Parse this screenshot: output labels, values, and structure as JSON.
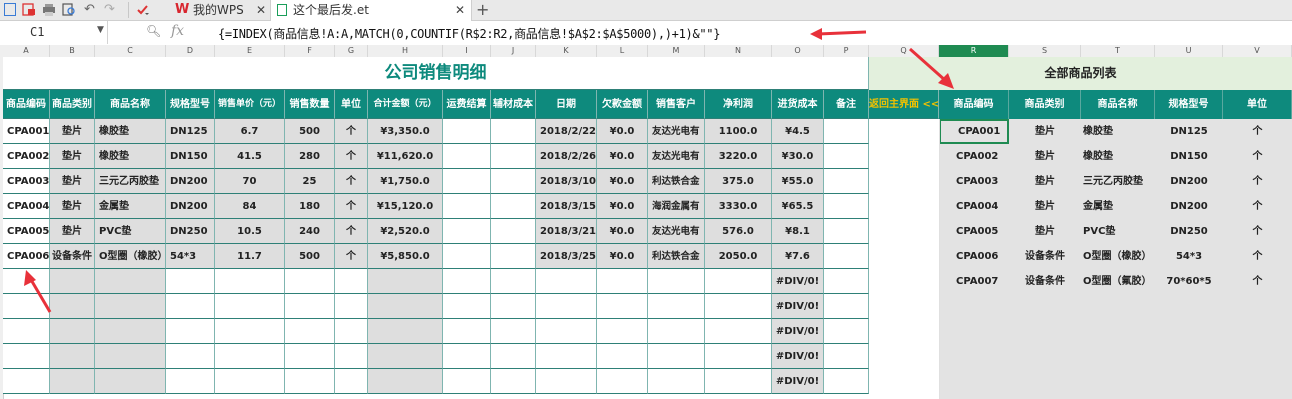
{
  "tabs": [
    {
      "label": "我的WPS",
      "icon": "wps-logo-icon"
    },
    {
      "label": "这个最后发.et",
      "icon": "spreadsheet-file-icon",
      "active": true
    }
  ],
  "namebox": {
    "value": "C1"
  },
  "formula": {
    "fx": "fx",
    "text": "{=INDEX(商品信息!A:A,MATCH(0,COUNTIF(R$2:R2,商品信息!$A$2:$A$5000),)+1)&\"\"}"
  },
  "columns": [
    "A",
    "B",
    "C",
    "D",
    "E",
    "F",
    "G",
    "H",
    "I",
    "J",
    "K",
    "L",
    "M",
    "N",
    "O",
    "P",
    "Q",
    "R",
    "S",
    "T",
    "U",
    "V"
  ],
  "sales": {
    "title": "公司销售明细",
    "headers": [
      "商品编码",
      "商品类别",
      "商品名称",
      "规格型号",
      "销售单价（元）",
      "销售数量",
      "单位",
      "合计金额（元）",
      "运费结算",
      "辅材成本",
      "日期",
      "欠款金额",
      "销售客户",
      "净利润",
      "进货成本",
      "备注"
    ],
    "rows": [
      [
        "CPA001",
        "垫片",
        "橡胶垫",
        "DN125",
        "6.7",
        "500",
        "个",
        "¥3,350.0",
        "",
        "",
        "2018/2/22",
        "¥0.0",
        "友达光电有",
        "1100.0",
        "¥4.5",
        ""
      ],
      [
        "CPA002",
        "垫片",
        "橡胶垫",
        "DN150",
        "41.5",
        "280",
        "个",
        "¥11,620.0",
        "",
        "",
        "2018/2/26",
        "¥0.0",
        "友达光电有",
        "3220.0",
        "¥30.0",
        ""
      ],
      [
        "CPA003",
        "垫片",
        "三元乙丙胶垫",
        "DN200",
        "70",
        "25",
        "个",
        "¥1,750.0",
        "",
        "",
        "2018/3/10",
        "¥0.0",
        "利达铁合金",
        "375.0",
        "¥55.0",
        ""
      ],
      [
        "CPA004",
        "垫片",
        "金属垫",
        "DN200",
        "84",
        "180",
        "个",
        "¥15,120.0",
        "",
        "",
        "2018/3/15",
        "¥0.0",
        "海润金属有",
        "3330.0",
        "¥65.5",
        ""
      ],
      [
        "CPA005",
        "垫片",
        "PVC垫",
        "DN250",
        "10.5",
        "240",
        "个",
        "¥2,520.0",
        "",
        "",
        "2018/3/21",
        "¥0.0",
        "友达光电有",
        "576.0",
        "¥8.1",
        ""
      ],
      [
        "CPA006",
        "设备条件",
        "O型圈（橡胶）",
        "54*3",
        "11.7",
        "500",
        "个",
        "¥5,850.0",
        "",
        "",
        "2018/3/25",
        "¥0.0",
        "利达铁合金",
        "2050.0",
        "¥7.6",
        ""
      ],
      [
        "",
        "",
        "",
        "",
        "",
        "",
        "",
        "",
        "",
        "",
        "",
        "",
        "",
        "",
        "#DIV/0!",
        ""
      ],
      [
        "",
        "",
        "",
        "",
        "",
        "",
        "",
        "",
        "",
        "",
        "",
        "",
        "",
        "",
        "#DIV/0!",
        ""
      ],
      [
        "",
        "",
        "",
        "",
        "",
        "",
        "",
        "",
        "",
        "",
        "",
        "",
        "",
        "",
        "#DIV/0!",
        ""
      ],
      [
        "",
        "",
        "",
        "",
        "",
        "",
        "",
        "",
        "",
        "",
        "",
        "",
        "",
        "",
        "#DIV/0!",
        ""
      ],
      [
        "",
        "",
        "",
        "",
        "",
        "",
        "",
        "",
        "",
        "",
        "",
        "",
        "",
        "",
        "#DIV/0!",
        ""
      ]
    ]
  },
  "back_link": "返回主界面 <<",
  "products": {
    "title": "全部商品列表",
    "headers": [
      "商品编码",
      "商品类别",
      "商品名称",
      "规格型号",
      "单位"
    ],
    "rows": [
      [
        "CPA001",
        "垫片",
        "橡胶垫",
        "DN125",
        "个"
      ],
      [
        "CPA002",
        "垫片",
        "橡胶垫",
        "DN150",
        "个"
      ],
      [
        "CPA003",
        "垫片",
        "三元乙丙胶垫",
        "DN200",
        "个"
      ],
      [
        "CPA004",
        "垫片",
        "金属垫",
        "DN200",
        "个"
      ],
      [
        "CPA005",
        "垫片",
        "PVC垫",
        "DN250",
        "个"
      ],
      [
        "CPA006",
        "设备条件",
        "O型圈（橡胶）",
        "54*3",
        "个"
      ],
      [
        "CPA007",
        "设备条件",
        "O型圈（氟胶）",
        "70*60*5",
        "个"
      ]
    ]
  },
  "colors": {
    "header_teal": "#0e8a7d",
    "title_teal": "#0e8a7d",
    "back_link": "#f2c200",
    "arrow": "#e8313a",
    "right_title_bg": "#e3f0dd"
  }
}
